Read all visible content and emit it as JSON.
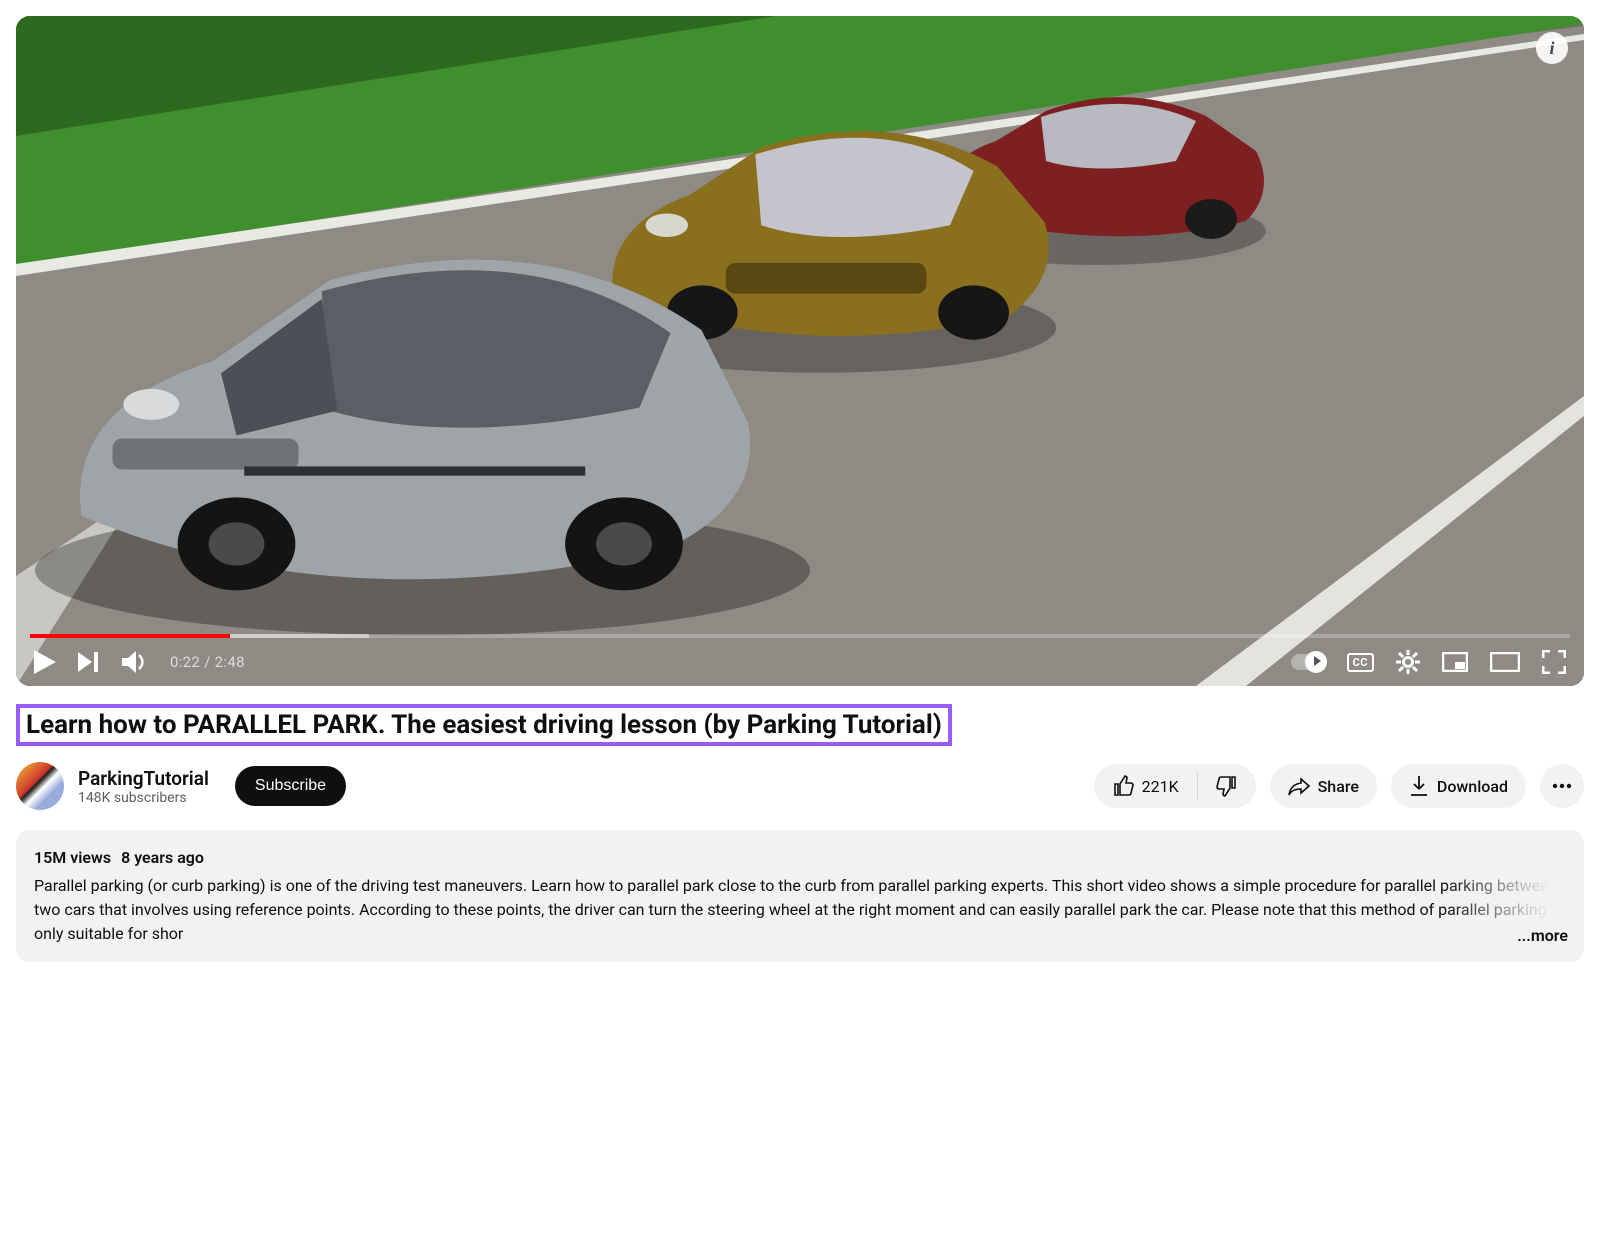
{
  "player": {
    "current_time": "0:22",
    "duration": "2:48",
    "cc_label": "CC",
    "info_icon": "i"
  },
  "video": {
    "title": "Learn how to PARALLEL PARK. The easiest driving lesson (by Parking Tutorial)"
  },
  "channel": {
    "name": "ParkingTutorial",
    "subscribers": "148K subscribers",
    "subscribe_label": "Subscribe"
  },
  "actions": {
    "likes": "221K",
    "share_label": "Share",
    "download_label": "Download"
  },
  "description": {
    "views": "15M views",
    "age": "8 years ago",
    "body": "Parallel parking (or curb parking) is one of the driving test maneuvers. Learn how to parallel park close to the curb from parallel parking experts. This short video shows a simple procedure for parallel parking between two cars that involves using reference points. According to these points, the driver can turn the steering wheel at the right moment and can easily parallel park the car. Please note that this method of parallel parking is only suitable for shor",
    "more_label": "...more"
  }
}
